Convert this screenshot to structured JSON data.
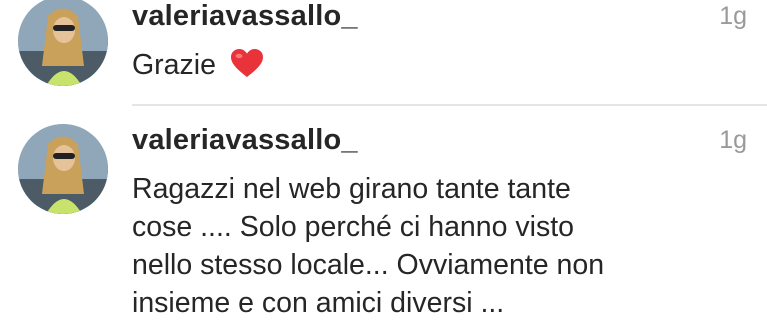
{
  "comments": [
    {
      "username": "valeriavassallo_",
      "time": "1g",
      "text": "Grazie",
      "emoji": "heart-emoji"
    },
    {
      "username": "valeriavassallo_",
      "time": "1g",
      "lines": [
        "Ragazzi nel web girano tante tante",
        "cose .... Solo perché ci hanno visto",
        "nello stesso locale... Ovviamente non",
        "insieme e con amici diversi ..."
      ]
    }
  ],
  "colors": {
    "text": "#262626",
    "timestamp": "#9a9a9a",
    "divider": "#e5e5e5",
    "heart": "#e8333b"
  }
}
